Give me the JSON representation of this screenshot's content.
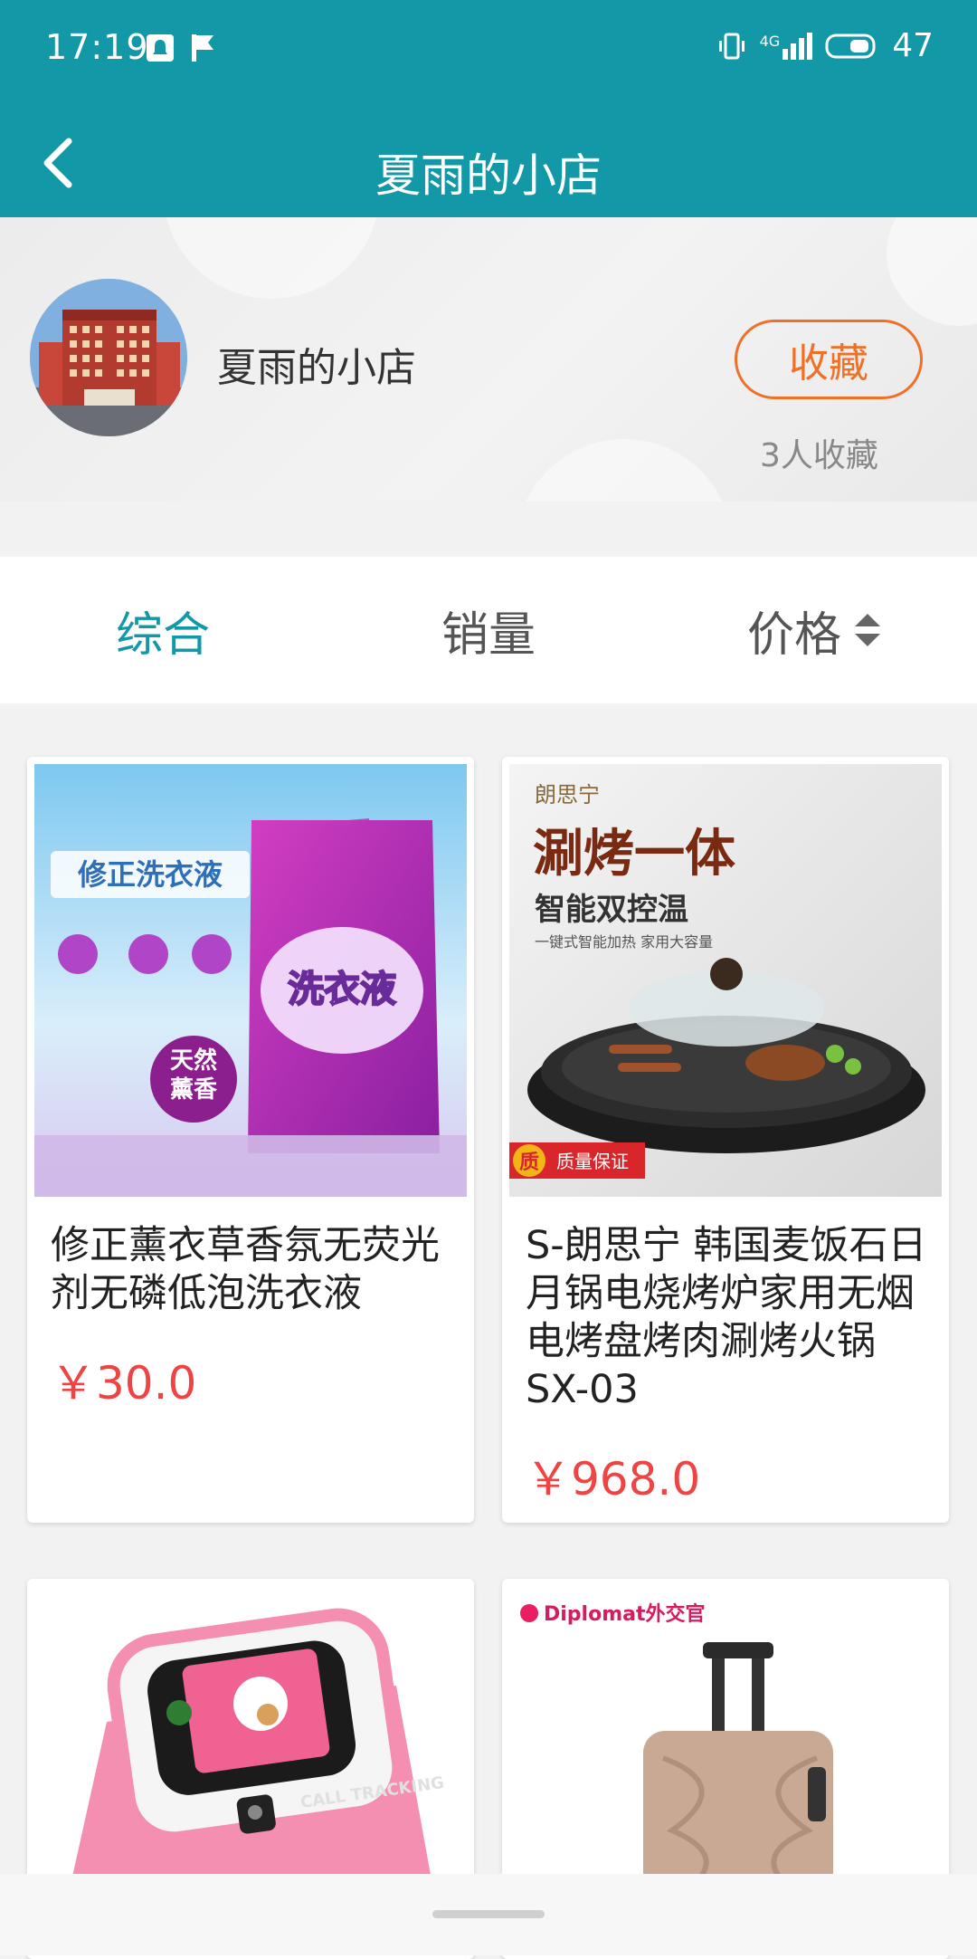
{
  "status_bar": {
    "time": "17:19",
    "network": "4G",
    "battery": "47"
  },
  "header": {
    "title": "夏雨的小店"
  },
  "store": {
    "name": "夏雨的小店",
    "favorite_label": "收藏",
    "favorite_count": "3人收藏"
  },
  "sort_tabs": [
    {
      "label": "综合",
      "active": true
    },
    {
      "label": "销量",
      "active": false
    },
    {
      "label": "价格",
      "active": false
    }
  ],
  "products": [
    {
      "title": "修正薰衣草香氛无荧光剂无磷低泡洗衣液",
      "price": "￥30.0",
      "image_text": {
        "headline": "修正洗衣液",
        "package_label": "洗衣液",
        "badge": "天然薰香"
      }
    },
    {
      "title": "S-朗思宁 韩国麦饭石日月锅电烧烤炉家用无烟电烤盘烤肉涮烤火锅 SX-03",
      "price": "￥968.0",
      "image_text": {
        "brand": "朗思宁",
        "headline": "涮烤一体",
        "subheadline": "智能双控温",
        "tagline": "一键式智能加热  家用大容量",
        "quality_badge": "质",
        "quality_text": "质量保证"
      }
    },
    {
      "title": "",
      "price": "",
      "image_text": {
        "band_text": "CALL TRACKING"
      }
    },
    {
      "title": "",
      "price": "",
      "image_text": {
        "brand": "Diplomat外交官"
      }
    }
  ],
  "colors": {
    "primary": "#1298a6",
    "accent_orange": "#f07027",
    "price_red": "#ee4444"
  }
}
